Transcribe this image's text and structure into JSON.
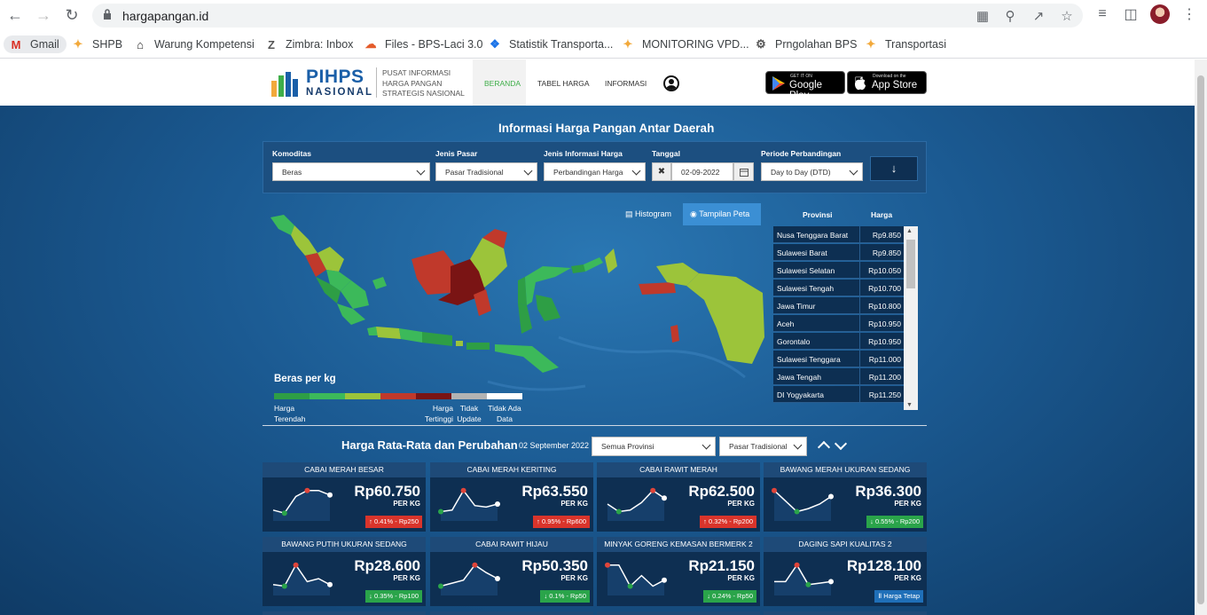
{
  "browser": {
    "url": "hargapangan.id",
    "bookmarks": [
      "Gmail",
      "SHPB",
      "Warung Kompetensi",
      "Zimbra: Inbox",
      "Files - BPS-Laci 3.0",
      "Statistik Transporta...",
      "MONITORING VPD...",
      "Prngolahan BPS",
      "Transportasi"
    ]
  },
  "header": {
    "logo_main": "PIHPS",
    "logo_sub": "NASIONAL",
    "tagline": [
      "PUSAT INFORMASI",
      "HARGA PANGAN",
      "STRATEGIS NASIONAL"
    ],
    "menu": [
      "BERANDA",
      "TABEL HARGA",
      "INFORMASI"
    ],
    "google_play_small": "GET IT ON",
    "google_play_big": "Google Play",
    "app_store_small": "Download on the",
    "app_store_big": "App Store"
  },
  "info": {
    "title": "Informasi Harga Pangan Antar Daerah",
    "filters": {
      "komoditas_label": "Komoditas",
      "komoditas_value": "Beras",
      "jenis_pasar_label": "Jenis Pasar",
      "jenis_pasar_value": "Pasar Tradisional",
      "jenis_info_label": "Jenis Informasi Harga",
      "jenis_info_value": "Perbandingan Harga",
      "tanggal_label": "Tanggal",
      "tanggal_value": "02-09-2022",
      "periode_label": "Periode Perbandingan",
      "periode_value": "Day to Day (DTD)"
    },
    "tabs": {
      "histogram": "Histogram",
      "peta": "Tampilan Peta"
    },
    "legend": {
      "title": "Beras per kg",
      "colors": [
        "#2e9e45",
        "#3cb95a",
        "#9cc43a",
        "#c0392b",
        "#7a1414",
        "#b3b3b3",
        "#ffffff"
      ],
      "low": "Harga Terendah",
      "high": "Harga Tertinggi",
      "no_update": "Tidak Update",
      "no_data": "Tidak Ada Data"
    },
    "table": {
      "col_prov": "Provinsi",
      "col_price": "Harga",
      "rows": [
        {
          "name": "Nusa Tenggara Barat",
          "price": "Rp9.850"
        },
        {
          "name": "Sulawesi Barat",
          "price": "Rp9.850"
        },
        {
          "name": "Sulawesi Selatan",
          "price": "Rp10.050"
        },
        {
          "name": "Sulawesi Tengah",
          "price": "Rp10.700"
        },
        {
          "name": "Jawa Timur",
          "price": "Rp10.800"
        },
        {
          "name": "Aceh",
          "price": "Rp10.950"
        },
        {
          "name": "Gorontalo",
          "price": "Rp10.950"
        },
        {
          "name": "Sulawesi Tenggara",
          "price": "Rp11.000"
        },
        {
          "name": "Jawa Tengah",
          "price": "Rp11.200"
        },
        {
          "name": "DI Yogyakarta",
          "price": "Rp11.250"
        }
      ]
    }
  },
  "prices": {
    "title": "Harga Rata-Rata dan Perubahan",
    "date": "02 September 2022",
    "province_select": "Semua Provinsi",
    "market_select": "Pasar Tradisional",
    "cards": [
      {
        "name": "CABAI MERAH BESAR",
        "price": "Rp60.750",
        "unit": "PER KG",
        "change": "0.41% - Rp250",
        "trend": "up",
        "spark": [
          0.3,
          0.2,
          0.75,
          0.95,
          0.95,
          0.8
        ]
      },
      {
        "name": "CABAI MERAH KERITING",
        "price": "Rp63.550",
        "unit": "PER KG",
        "change": "0.95% - Rp600",
        "trend": "up",
        "spark": [
          0.25,
          0.3,
          0.95,
          0.45,
          0.4,
          0.5
        ]
      },
      {
        "name": "CABAI RAWIT MERAH",
        "price": "Rp62.500",
        "unit": "PER KG",
        "change": "0.32% - Rp200",
        "trend": "up",
        "spark": [
          0.5,
          0.25,
          0.3,
          0.55,
          0.95,
          0.7
        ]
      },
      {
        "name": "BAWANG MERAH UKURAN SEDANG",
        "price": "Rp36.300",
        "unit": "PER KG",
        "change": "0.55% - Rp200",
        "trend": "down",
        "spark": [
          0.95,
          0.6,
          0.25,
          0.35,
          0.5,
          0.75
        ]
      },
      {
        "name": "BAWANG PUTIH UKURAN SEDANG",
        "price": "Rp28.600",
        "unit": "PER KG",
        "change": "0.35% - Rp100",
        "trend": "down",
        "spark": [
          0.3,
          0.25,
          0.95,
          0.4,
          0.5,
          0.3
        ]
      },
      {
        "name": "CABAI RAWIT HIJAU",
        "price": "Rp50.350",
        "unit": "PER KG",
        "change": "0.1% - Rp50",
        "trend": "down",
        "spark": [
          0.25,
          0.35,
          0.45,
          0.95,
          0.7,
          0.5
        ]
      },
      {
        "name": "MINYAK GORENG KEMASAN BERMERK 2",
        "price": "Rp21.150",
        "unit": "PER KG",
        "change": "0.24% - Rp50",
        "trend": "down",
        "spark": [
          0.95,
          0.95,
          0.25,
          0.6,
          0.25,
          0.45
        ]
      },
      {
        "name": "DAGING SAPI KUALITAS 2",
        "price": "Rp128.100",
        "unit": "PER KG",
        "change": "Harga Tetap",
        "trend": "flat",
        "spark": [
          0.4,
          0.4,
          0.95,
          0.3,
          0.35,
          0.4
        ]
      }
    ]
  }
}
